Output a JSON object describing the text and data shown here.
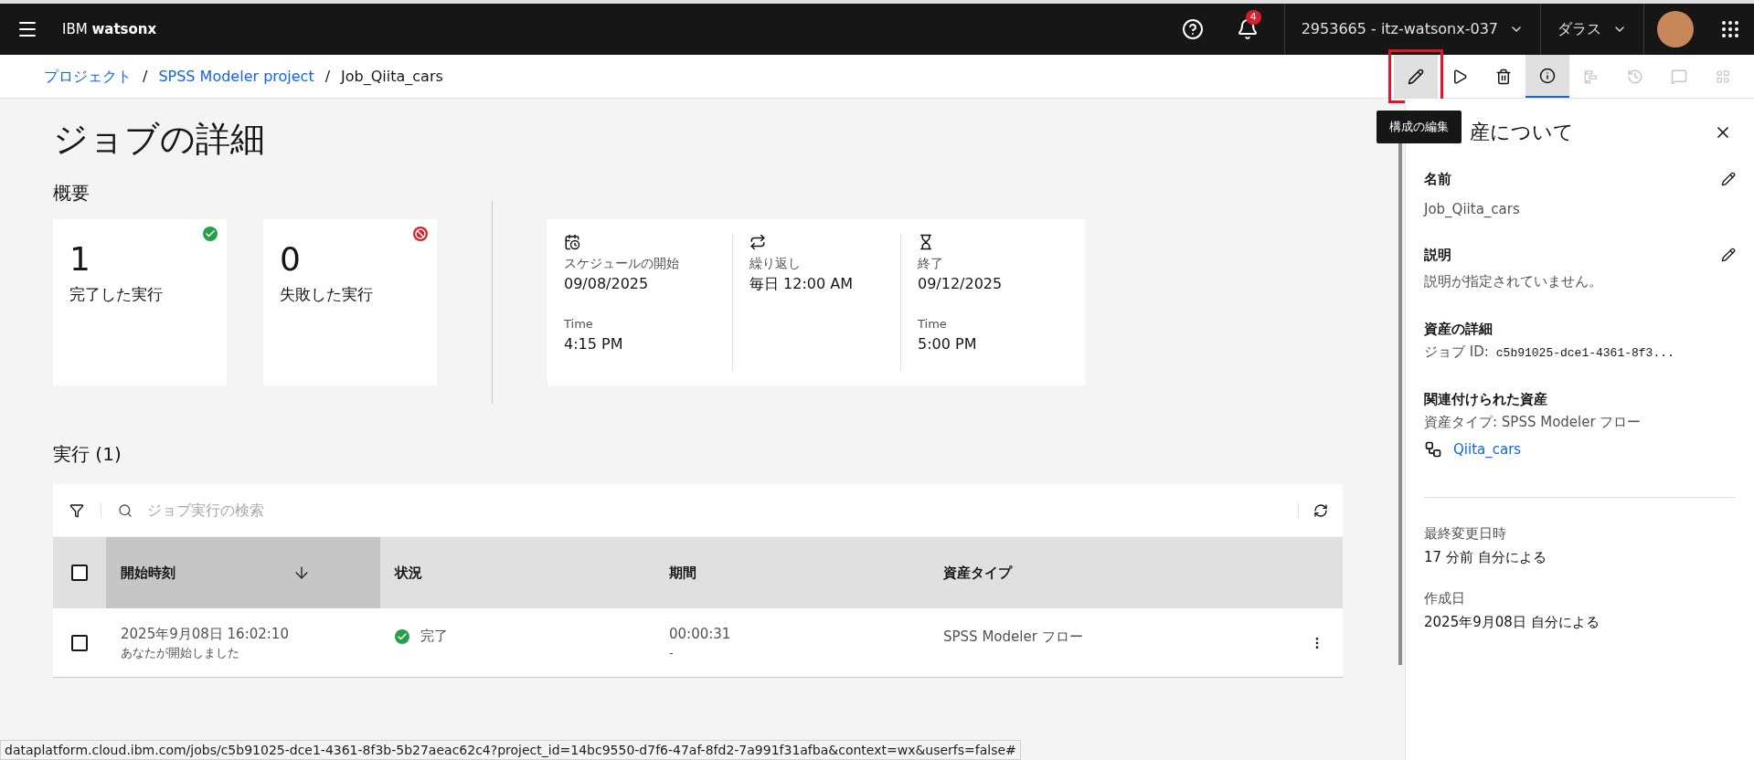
{
  "header": {
    "brand_prefix": "IBM",
    "brand_name": "watsonx",
    "notification_count": "4",
    "account": "2953665 - itz-watsonx-037",
    "region": "ダラス"
  },
  "breadcrumbs": [
    {
      "label": "プロジェクト",
      "link": true
    },
    {
      "separator": "/",
      "label": "SPSS Modeler project",
      "link": true
    },
    {
      "separator": "/",
      "label": "Job_Qiita_cars",
      "link": false
    }
  ],
  "toolbar": [
    {
      "selected": false,
      "disabled": false,
      "highlighted": true
    },
    {
      "selected": false,
      "disabled": false,
      "highlighted": false
    },
    {
      "selected": false,
      "disabled": false,
      "highlighted": false
    },
    {
      "selected": true,
      "disabled": false,
      "highlighted": false
    },
    {
      "selected": false,
      "disabled": true,
      "highlighted": false
    },
    {
      "selected": false,
      "disabled": true,
      "highlighted": false
    },
    {
      "selected": false,
      "disabled": true,
      "highlighted": false
    },
    {
      "selected": false,
      "disabled": true,
      "highlighted": false
    }
  ],
  "tooltip": "構成の編集",
  "page_title": "ジョブの詳細",
  "overview": {
    "heading": "概要",
    "stats": [
      {
        "value": "1",
        "label": "完了した実行",
        "kind": "success"
      },
      {
        "value": "0",
        "label": "失敗した実行",
        "kind": "failed"
      }
    ],
    "schedule": [
      {
        "label": "スケジュールの開始",
        "value": "09/08/2025",
        "time_label": "Time",
        "time_value": "4:15 PM"
      },
      {
        "label": "繰り返し",
        "value": "毎日 12:00 AM"
      },
      {
        "label": "終了",
        "value": "09/12/2025",
        "time_label": "Time",
        "time_value": "5:00 PM"
      }
    ]
  },
  "runs": {
    "heading": "実行 (1)",
    "search": {
      "placeholder": "ジョブ実行の検索"
    },
    "header_checked": false,
    "columns": [
      {
        "label": "開始時刻",
        "sorted": true
      },
      {
        "label": "状況",
        "sorted": false
      },
      {
        "label": "期間",
        "sorted": false
      },
      {
        "label": "資産タイプ",
        "sorted": false
      }
    ],
    "rows": [
      {
        "checked": false,
        "start": "2025年9月08日 16:02:10",
        "started_by": "あなたが開始しました",
        "status": "完了",
        "kind": "success",
        "duration": "00:00:31",
        "duration_sub": "-",
        "asset_type": "SPSS Modeler フロー"
      }
    ]
  },
  "panel": {
    "title": "産について",
    "name": {
      "label": "名前",
      "value": "Job_Qiita_cars"
    },
    "description": {
      "label": "説明",
      "value": "説明が指定されていません。"
    },
    "details": {
      "label": "資産の詳細",
      "id_label": "ジョブ ID:",
      "id_value": "c5b91025-dce1-4361-8f3..."
    },
    "related": {
      "label": "関連付けられた資産",
      "type": "資産タイプ: SPSS Modeler フロー",
      "link": "Qiita_cars"
    },
    "modified": {
      "label": "最終変更日時",
      "value": "17 分前 自分による"
    },
    "created": {
      "label": "作成日",
      "value": "2025年9月08日 自分による"
    }
  },
  "status_url": "dataplatform.cloud.ibm.com/jobs/c5b91025-dce1-4361-8f3b-5b27aeac62c4?project_id=14bc9550-d7f6-47af-8fd2-7a991f31afba&context=wx&userfs=false#"
}
